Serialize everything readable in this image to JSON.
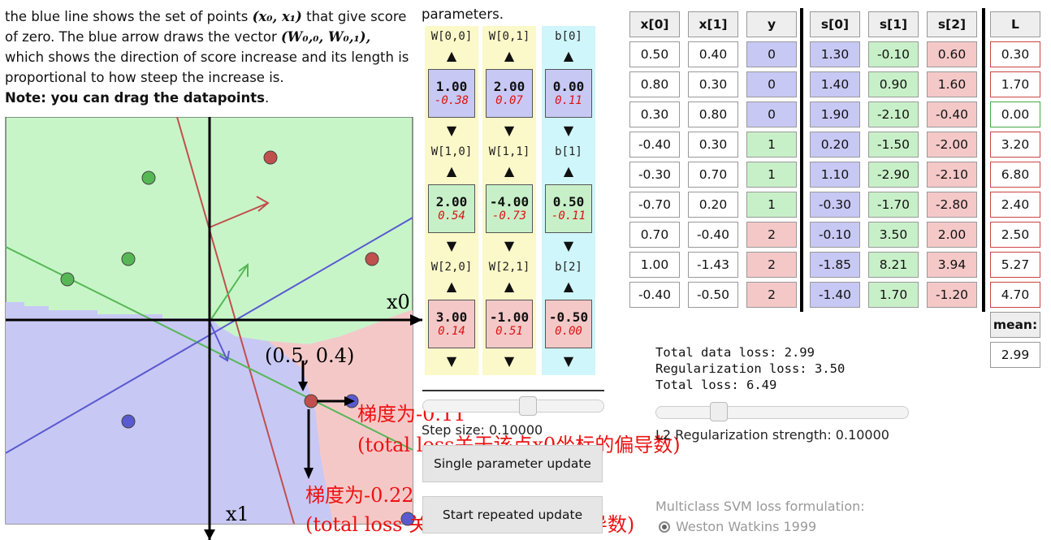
{
  "description": {
    "line1_pre": "the blue line shows the set of points",
    "line1_math": "(x₀, x₁)",
    "line1_post": "that give score",
    "line2_pre": "of zero. The blue arrow draws the vector",
    "line2_math": "(W₀,₀, W₀,₁),",
    "line3": "which shows the direction of score increase and its length is",
    "line4": "proportional to how steep the increase is.",
    "note": "Note: you can drag the datapoints"
  },
  "params_label": "parameters.",
  "weights": {
    "col_labels": [
      [
        "W[0,0]",
        "W[1,0]",
        "W[2,0]"
      ],
      [
        "W[0,1]",
        "W[1,1]",
        "W[2,1]"
      ],
      [
        "b[0]",
        "b[1]",
        "b[2]"
      ]
    ],
    "rows": [
      [
        {
          "v": "1.00",
          "g": "-0.38"
        },
        {
          "v": "2.00",
          "g": "0.07"
        },
        {
          "v": "0.00",
          "g": "0.11"
        }
      ],
      [
        {
          "v": "2.00",
          "g": "0.54"
        },
        {
          "v": "-4.00",
          "g": "-0.73"
        },
        {
          "v": "0.50",
          "g": "-0.11"
        }
      ],
      [
        {
          "v": "3.00",
          "g": "0.14"
        },
        {
          "v": "-1.00",
          "g": "0.51"
        },
        {
          "v": "-0.50",
          "g": "0.00"
        }
      ]
    ],
    "colors": {
      "class0": "#c8c8f5",
      "class1": "#c8f0c8",
      "class2": "#f5c8c8",
      "colW": "#fbf8c9",
      "colB": "#cff6fb"
    }
  },
  "table": {
    "headers": [
      "x[0]",
      "x[1]",
      "y",
      "s[0]",
      "s[1]",
      "s[2]",
      "L"
    ],
    "rows": [
      [
        "0.50",
        "0.40",
        "0",
        "1.30",
        "-0.10",
        "0.60",
        "0.30"
      ],
      [
        "0.80",
        "0.30",
        "0",
        "1.40",
        "0.90",
        "1.60",
        "1.70"
      ],
      [
        "0.30",
        "0.80",
        "0",
        "1.90",
        "-2.10",
        "-0.40",
        "0.00"
      ],
      [
        "-0.40",
        "0.30",
        "1",
        "0.20",
        "-1.50",
        "-2.00",
        "3.20"
      ],
      [
        "-0.30",
        "0.70",
        "1",
        "1.10",
        "-2.90",
        "-2.10",
        "6.80"
      ],
      [
        "-0.70",
        "0.20",
        "1",
        "-0.30",
        "-1.70",
        "-2.80",
        "2.40"
      ],
      [
        "0.70",
        "-0.40",
        "2",
        "-0.10",
        "3.50",
        "2.00",
        "2.50"
      ],
      [
        "1.00",
        "-1.43",
        "2",
        "-1.85",
        "8.21",
        "3.94",
        "5.27"
      ],
      [
        "-0.40",
        "-0.50",
        "2",
        "-1.40",
        "1.70",
        "-1.20",
        "4.70"
      ]
    ],
    "mean_label": "mean:",
    "mean_value": "2.99"
  },
  "loss": {
    "data_loss": "Total data loss: 2.99",
    "reg_loss": "Regularization loss: 3.50",
    "total_loss": "Total loss: 6.49"
  },
  "controls": {
    "step_size": "Step size: 0.10000",
    "reg_strength": "L2 Regularization strength: 0.10000",
    "single_update": "Single parameter update",
    "repeated_update": "Start repeated update",
    "formulation_label": "Multiclass SVM loss formulation:",
    "formulation_option": "Weston Watkins 1999"
  },
  "plot": {
    "axis_x0": "x0",
    "axis_x1": "x1",
    "point_label": "(0.5, 0.4)",
    "region_colors": {
      "green": "#c8f5c8",
      "blue": "#c8c8f5",
      "red": "#f5c8c8"
    },
    "points": [
      {
        "cls": 0,
        "x": 0.5,
        "y": 0.4
      },
      {
        "cls": 0,
        "x": 0.8,
        "y": 0.3
      },
      {
        "cls": 0,
        "x": 0.3,
        "y": 0.8
      },
      {
        "cls": 1,
        "x": -0.4,
        "y": 0.3
      },
      {
        "cls": 1,
        "x": -0.3,
        "y": 0.7
      },
      {
        "cls": 1,
        "x": -0.7,
        "y": 0.2
      },
      {
        "cls": 2,
        "x": 0.7,
        "y": -0.4
      },
      {
        "cls": 2,
        "x": 1.0,
        "y": -1.43
      },
      {
        "cls": 2,
        "x": -0.4,
        "y": -0.5
      }
    ]
  },
  "annotations": {
    "grad_x0": "梯度为-0.11",
    "grad_x0_note": "(total loss关于该点x0坐标的偏导数)",
    "grad_x1": "梯度为-0.22",
    "grad_x1_note": "(total loss 关于该点x1坐标的偏导数)"
  }
}
